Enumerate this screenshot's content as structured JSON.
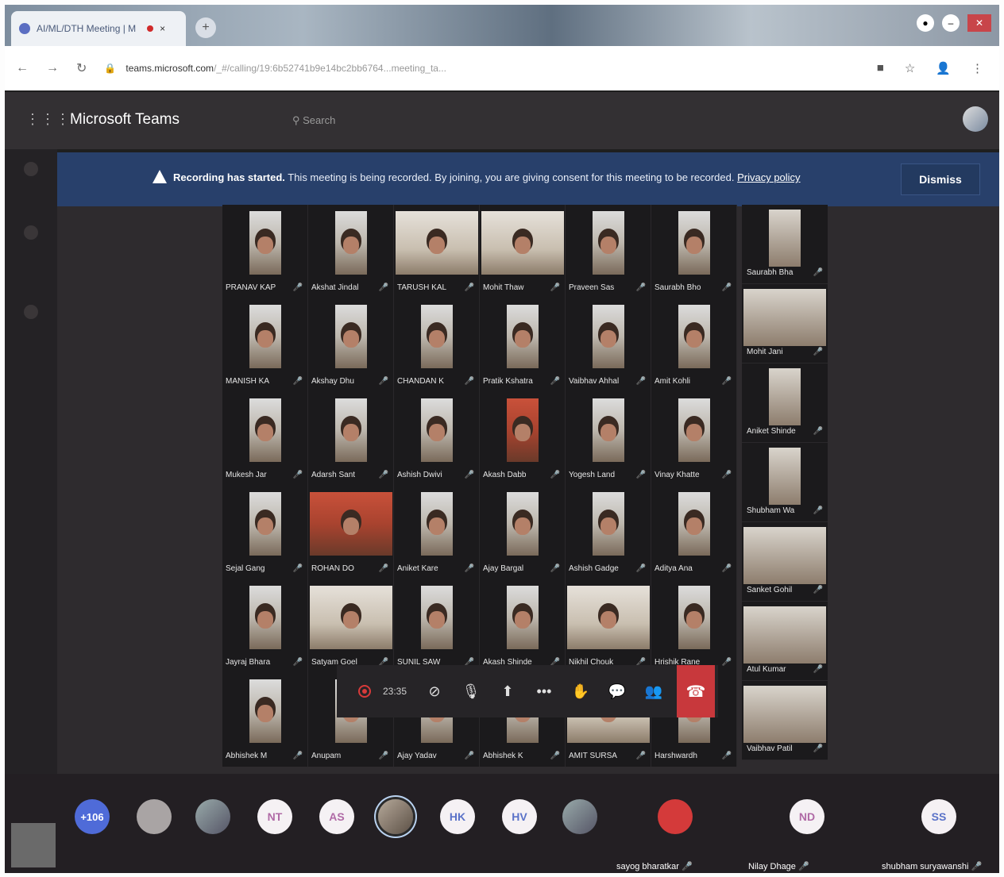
{
  "browser": {
    "tab_title": "AI/ML/DTH Meeting | M",
    "new_tab_icon": "plus-icon",
    "url_host": "teams.microsoft.com",
    "url_path": "/_#/calling/19:6b52741b9e14bc2bb6764...meeting_ta..."
  },
  "teams": {
    "app_title": "Microsoft Teams",
    "search_placeholder": "Search"
  },
  "banner": {
    "title": "Recording has started.",
    "message": "This meeting is being recorded. By joining, you are giving consent for this meeting to be recorded.",
    "link": "Privacy policy",
    "dismiss": "Dismiss"
  },
  "grid": {
    "tiles": [
      {
        "name": "PRANAV KAP"
      },
      {
        "name": "Akshat Jindal"
      },
      {
        "name": "TARUSH KAL"
      },
      {
        "name": "Mohit Thaw"
      },
      {
        "name": "Praveen Sas"
      },
      {
        "name": "Saurabh Bho"
      },
      {
        "name": "MANISH KA"
      },
      {
        "name": "Akshay Dhu"
      },
      {
        "name": "CHANDAN K"
      },
      {
        "name": "Pratik Kshatra"
      },
      {
        "name": "Vaibhav Ahhal"
      },
      {
        "name": "Amit Kohli"
      },
      {
        "name": "Mukesh Jar"
      },
      {
        "name": "Adarsh Sant"
      },
      {
        "name": "Ashish Dwivi"
      },
      {
        "name": "Akash Dabb"
      },
      {
        "name": "Yogesh Land"
      },
      {
        "name": "Vinay Khatte"
      },
      {
        "name": "Sejal Gang"
      },
      {
        "name": "ROHAN DO"
      },
      {
        "name": "Aniket Kare"
      },
      {
        "name": "Ajay Bargal"
      },
      {
        "name": "Ashish Gadge"
      },
      {
        "name": "Aditya Ana"
      },
      {
        "name": "Jayraj Bhara"
      },
      {
        "name": "Satyam Goel"
      },
      {
        "name": "SUNIL SAW"
      },
      {
        "name": "Akash Shinde"
      },
      {
        "name": "Nikhil Chouk"
      },
      {
        "name": "Hrishik Rane"
      },
      {
        "name": "Abhishek M"
      },
      {
        "name": "Anupam"
      },
      {
        "name": "Ajay Yadav"
      },
      {
        "name": "Abhishek K"
      },
      {
        "name": "AMIT SURSA"
      },
      {
        "name": "Harshwardh"
      }
    ],
    "side": [
      {
        "name": "Saurabh Bha"
      },
      {
        "name": "Mohit Jani"
      },
      {
        "name": "Aniket Shinde"
      },
      {
        "name": "Shubham Wa"
      },
      {
        "name": "Sanket Gohil"
      },
      {
        "name": "Atul Kumar"
      },
      {
        "name": "Vaibhav Patil"
      }
    ]
  },
  "controls": {
    "timer": "23:35",
    "record_icon": "record-icon",
    "camera_icon": "camera-off-icon",
    "mic_icon": "mic-off-icon",
    "share_icon": "share-tray-icon",
    "more_icon": "more-icon",
    "hand_icon": "raise-hand-icon",
    "chat_icon": "chat-icon",
    "people_icon": "people-icon",
    "hangup_icon": "hang-up-icon"
  },
  "participants": {
    "more_count": "+106",
    "initials": [
      "NT",
      "AS",
      "HK",
      "HV",
      "ND",
      "SS"
    ],
    "labels": [
      "sayog bharatkar",
      "Nilay Dhage",
      "shubham suryawanshi"
    ]
  },
  "colors": {
    "banner": "#28406b",
    "hangup": "#c8383c",
    "more_badge": "#4f6bd8"
  }
}
